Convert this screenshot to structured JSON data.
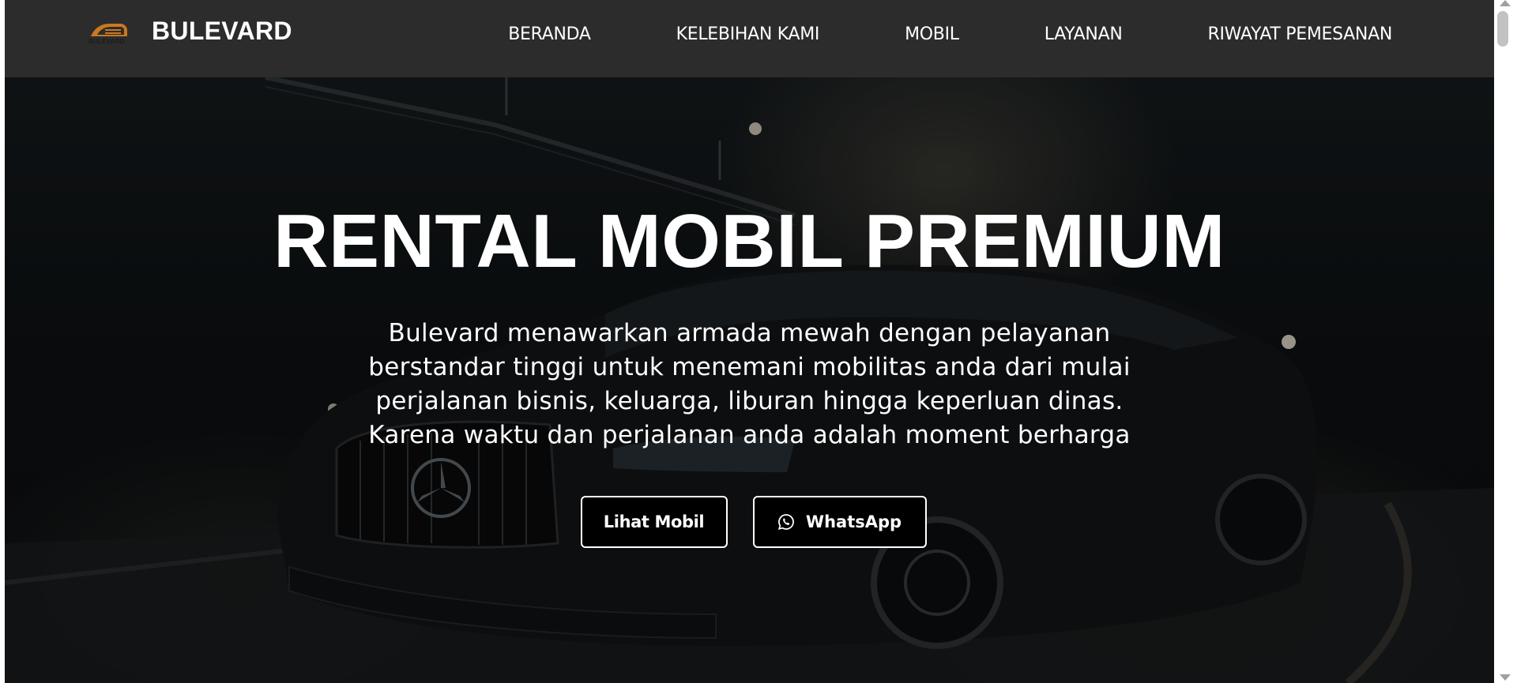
{
  "brand": {
    "logo_text": "BULEVARD",
    "name": "BULEVARD",
    "accent_color": "#c9791f"
  },
  "nav": {
    "items": [
      {
        "label": "BERANDA"
      },
      {
        "label": "KELEBIHAN KAMI"
      },
      {
        "label": "MOBIL"
      },
      {
        "label": "LAYANAN"
      },
      {
        "label": "RIWAYAT PEMESANAN"
      }
    ]
  },
  "hero": {
    "title": "RENTAL MOBIL PREMIUM",
    "description": "Bulevard menawarkan armada mewah dengan pelayanan berstandar tinggi untuk menemani mobilitas anda dari mulai perjalanan bisnis, keluarga, liburan hingga keperluan dinas. Karena waktu dan perjalanan anda adalah moment berharga",
    "buttons": {
      "cars_label": "Lihat Mobil",
      "whatsapp_label": "WhatsApp",
      "whatsapp_icon": "whatsapp-icon"
    }
  }
}
